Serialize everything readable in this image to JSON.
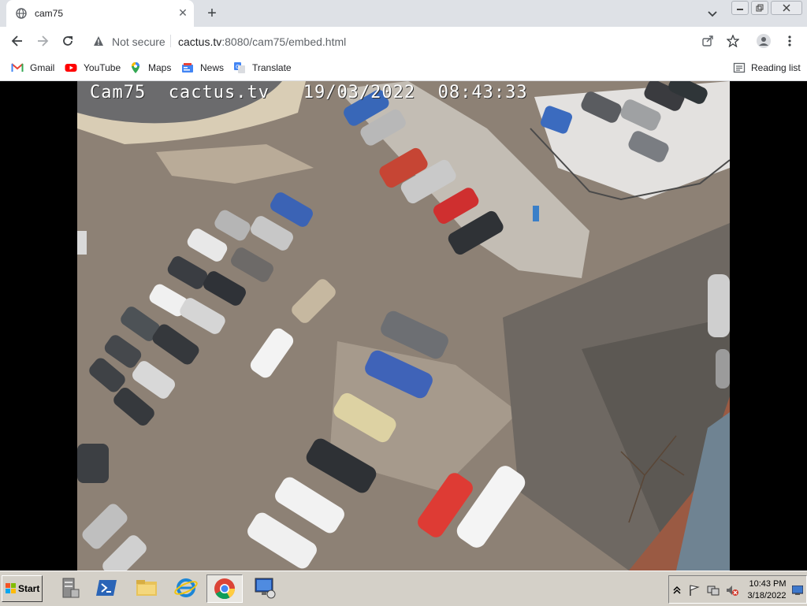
{
  "browser": {
    "tab": {
      "title": "cam75",
      "favicon": "globe-icon"
    },
    "security_label": "Not secure",
    "url_host": "cactus.tv",
    "url_rest": ":8080/cam75/embed.html"
  },
  "bookmarks": [
    {
      "label": "Gmail",
      "icon": "gmail-icon"
    },
    {
      "label": "YouTube",
      "icon": "youtube-icon"
    },
    {
      "label": "Maps",
      "icon": "maps-icon"
    },
    {
      "label": "News",
      "icon": "news-icon"
    },
    {
      "label": "Translate",
      "icon": "translate-icon"
    }
  ],
  "reading_list": "Reading list",
  "camera": {
    "overlay_name": "Cam75",
    "overlay_site": "cactus.tv",
    "overlay_timestamp": "19/03/2022  08:43:33"
  },
  "taskbar": {
    "start_label": "Start",
    "clock_time": "10:43 PM",
    "clock_date": "3/18/2022"
  },
  "colors": {
    "tab_strip": "#dee1e6",
    "taskbar": "#d4d0c8",
    "asphalt": "#8b7f73"
  }
}
